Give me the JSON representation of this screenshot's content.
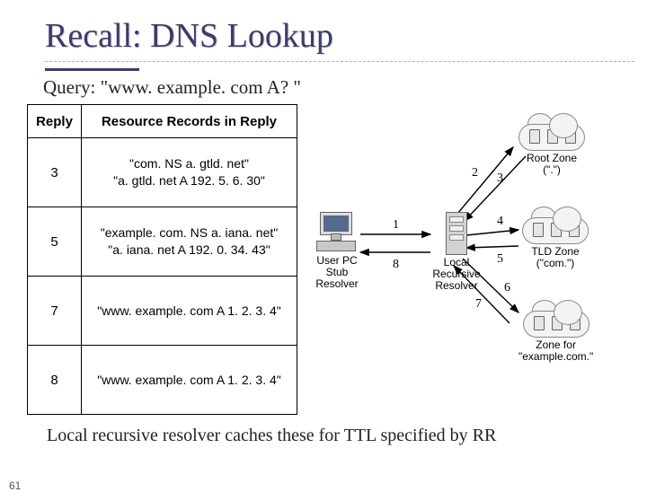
{
  "page_number": "61",
  "title": "Recall:  DNS Lookup",
  "query_line": "Query: \"www. example. com A? \"",
  "table": {
    "headers": {
      "reply": "Reply",
      "rr": "Resource Records in Reply"
    },
    "rows": [
      {
        "reply": "3",
        "rr_l1": "\"com. NS a. gtld. net\"",
        "rr_l2": "\"a. gtld. net A 192. 5. 6. 30\""
      },
      {
        "reply": "5",
        "rr_l1": "\"example. com. NS a. iana. net\"",
        "rr_l2": "\"a. iana. net A 192. 0. 34. 43\""
      },
      {
        "reply": "7",
        "rr_l1": "\"www. example. com A 1. 2. 3. 4\"",
        "rr_l2": ""
      },
      {
        "reply": "8",
        "rr_l1": "\"www. example. com A 1. 2. 3. 4\"",
        "rr_l2": ""
      }
    ]
  },
  "diagram": {
    "nodes": {
      "user_pc": "User PC\nStub\nResolver",
      "local_resolver": "Local\nRecursive\nResolver",
      "root_zone": "Root Zone\n(\".\")",
      "tld_zone": "TLD Zone\n(\"com.\")",
      "auth_zone": "Zone for\n\"example.com.\""
    },
    "arrow_labels": {
      "a1": "1",
      "a2": "2",
      "a3": "3",
      "a4": "4",
      "a5": "5",
      "a6": "6",
      "a7": "7",
      "a8": "8"
    }
  },
  "footer": "Local recursive resolver caches these for TTL specified by RR"
}
